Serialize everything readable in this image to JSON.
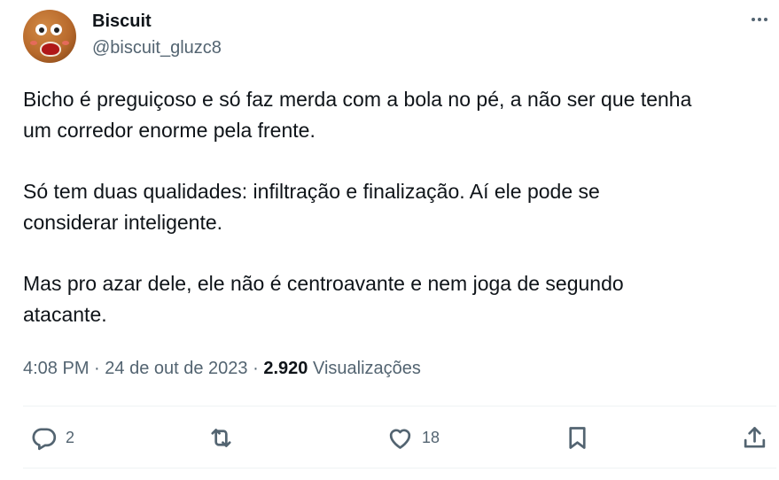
{
  "tweet": {
    "author": {
      "name": "Biscuit",
      "handle": "@biscuit_gluzc8",
      "avatar_icon": "gingerbread-avatar-icon"
    },
    "more_icon": "more-horizontal-icon",
    "paragraphs": [
      "Bicho é preguiçoso e só faz merda com a bola no pé, a não ser que tenha\num corredor enorme pela frente.",
      "Só tem duas qualidades: infiltração e finalização. Aí ele pode se\nconsiderar inteligente.",
      "Mas pro azar dele, ele não é centroavante e nem joga de segundo\natacante."
    ],
    "time": "4:08 PM",
    "dot1": "·",
    "date": "24 de out de 2023",
    "dot2": "·",
    "views_count": "2.920",
    "views_label": "Visualizações"
  },
  "actions": {
    "reply": {
      "icon": "reply-icon",
      "count": "2"
    },
    "retweet": {
      "icon": "retweet-icon",
      "count": ""
    },
    "like": {
      "icon": "heart-icon",
      "count": "18"
    },
    "bookmark": {
      "icon": "bookmark-icon",
      "count": ""
    },
    "share": {
      "icon": "share-icon",
      "count": ""
    }
  },
  "colors": {
    "text": "#0f1419",
    "secondary": "#536471",
    "divider": "#eff3f4"
  }
}
